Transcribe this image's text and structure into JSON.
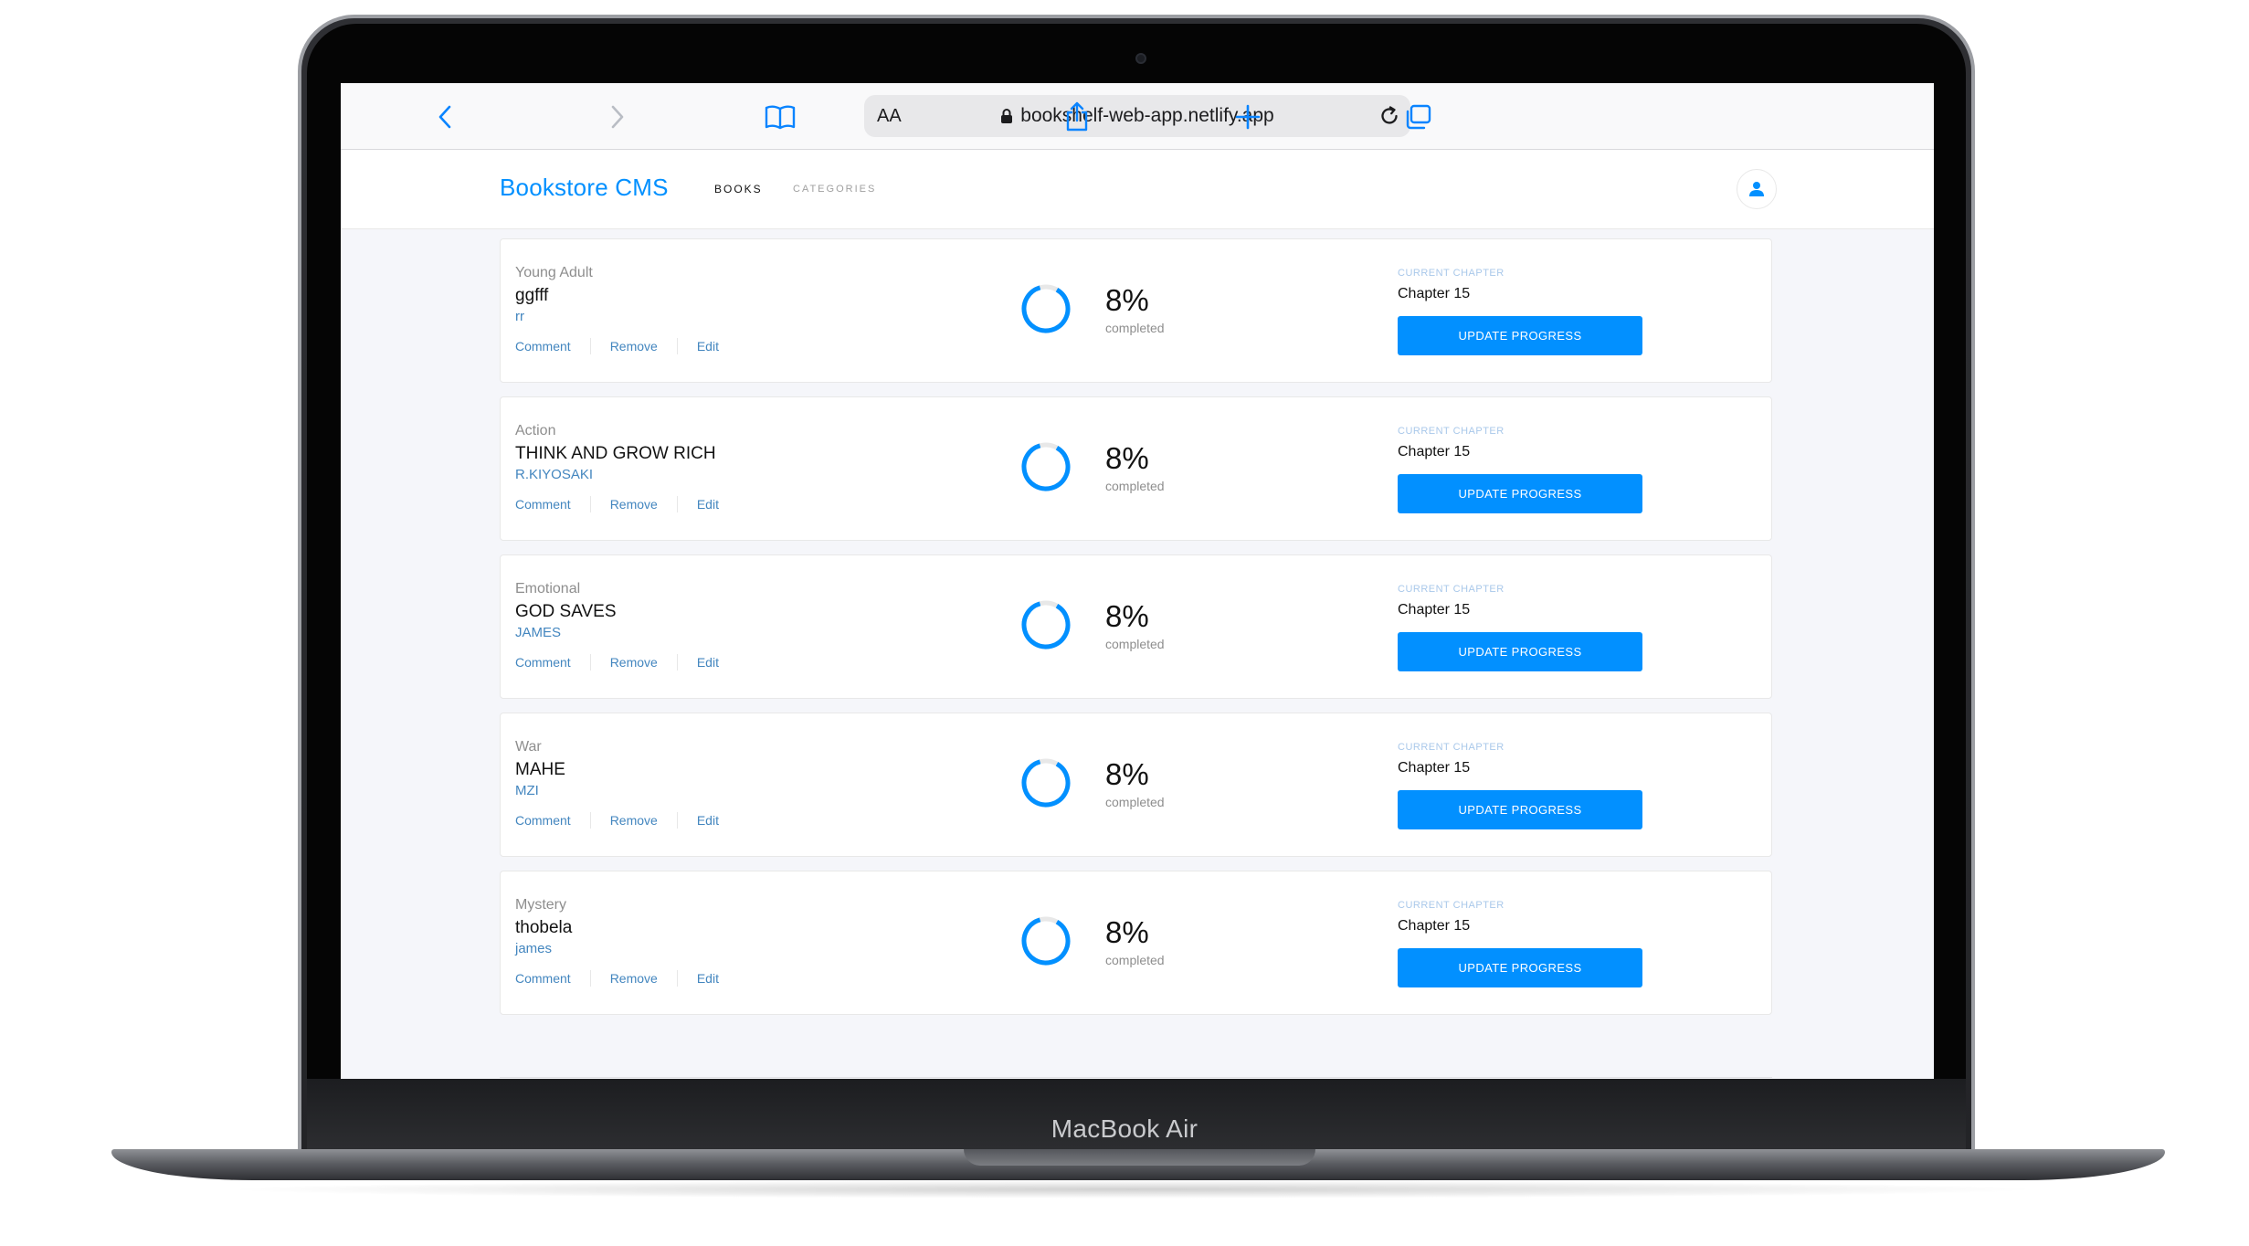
{
  "device": {
    "label": "MacBook Air"
  },
  "browser": {
    "text_size_label": "AA",
    "url": "bookshelf-web-app.netlify.app"
  },
  "app": {
    "brand": "Bookstore CMS",
    "nav": {
      "books": "BOOKS",
      "categories": "CATEGORIES"
    }
  },
  "colors": {
    "accent": "#0290ff",
    "link": "#4386bf",
    "background": "#f5f6fa"
  },
  "books": [
    {
      "genre": "Young Adult",
      "title": "ggfff",
      "author": "rr",
      "progress_percent": 8,
      "percent_label": "8%",
      "completed_label": "completed",
      "chapter_label": "CURRENT CHAPTER",
      "chapter": "Chapter 15",
      "comment_label": "Comment",
      "remove_label": "Remove",
      "edit_label": "Edit",
      "update_label": "UPDATE PROGRESS"
    },
    {
      "genre": "Action",
      "title": "THINK AND GROW RICH",
      "author": "R.KIYOSAKI",
      "progress_percent": 8,
      "percent_label": "8%",
      "completed_label": "completed",
      "chapter_label": "CURRENT CHAPTER",
      "chapter": "Chapter 15",
      "comment_label": "Comment",
      "remove_label": "Remove",
      "edit_label": "Edit",
      "update_label": "UPDATE PROGRESS"
    },
    {
      "genre": "Emotional",
      "title": "GOD SAVES",
      "author": "JAMES",
      "progress_percent": 8,
      "percent_label": "8%",
      "completed_label": "completed",
      "chapter_label": "CURRENT CHAPTER",
      "chapter": "Chapter 15",
      "comment_label": "Comment",
      "remove_label": "Remove",
      "edit_label": "Edit",
      "update_label": "UPDATE PROGRESS"
    },
    {
      "genre": "War",
      "title": "MAHE",
      "author": "MZI",
      "progress_percent": 8,
      "percent_label": "8%",
      "completed_label": "completed",
      "chapter_label": "CURRENT CHAPTER",
      "chapter": "Chapter 15",
      "comment_label": "Comment",
      "remove_label": "Remove",
      "edit_label": "Edit",
      "update_label": "UPDATE PROGRESS"
    },
    {
      "genre": "Mystery",
      "title": "thobela",
      "author": "james",
      "progress_percent": 8,
      "percent_label": "8%",
      "completed_label": "completed",
      "chapter_label": "CURRENT CHAPTER",
      "chapter": "Chapter 15",
      "comment_label": "Comment",
      "remove_label": "Remove",
      "edit_label": "Edit",
      "update_label": "UPDATE PROGRESS"
    }
  ]
}
